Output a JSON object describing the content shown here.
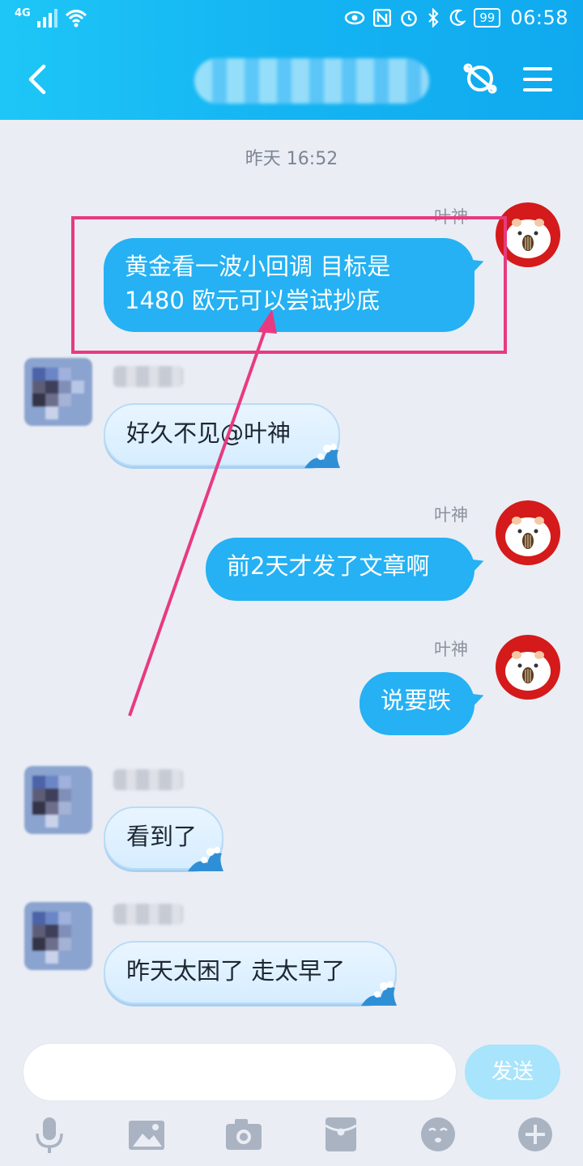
{
  "status_bar": {
    "network": "4G",
    "battery": "99",
    "time": "06:58"
  },
  "header": {
    "title": ""
  },
  "chat": {
    "timestamp": "昨天 16:52",
    "messages": [
      {
        "sender": "叶神",
        "side": "right",
        "text_line1": "黄金看一波小回调 目标是",
        "text_line2": "1480 欧元可以尝试抄底"
      },
      {
        "sender": "",
        "side": "left",
        "text": "好久不见@叶神"
      },
      {
        "sender": "叶神",
        "side": "right",
        "text": "前2天才发了文章啊"
      },
      {
        "sender": "叶神",
        "side": "right",
        "text": "说要跌"
      },
      {
        "sender": "",
        "side": "left",
        "text": "看到了"
      },
      {
        "sender": "",
        "side": "left",
        "text": "昨天太困了 走太早了"
      }
    ]
  },
  "composer": {
    "send_label": "发送"
  },
  "toolbar": {
    "icons": [
      "microphone-icon",
      "image-icon",
      "camera-icon",
      "red-packet-icon",
      "emoji-icon",
      "plus-icon"
    ]
  },
  "colors": {
    "header": "#14b4f2",
    "my_bubble": "#25b1f3",
    "highlight": "#e83a80",
    "background": "#eaedf4"
  }
}
